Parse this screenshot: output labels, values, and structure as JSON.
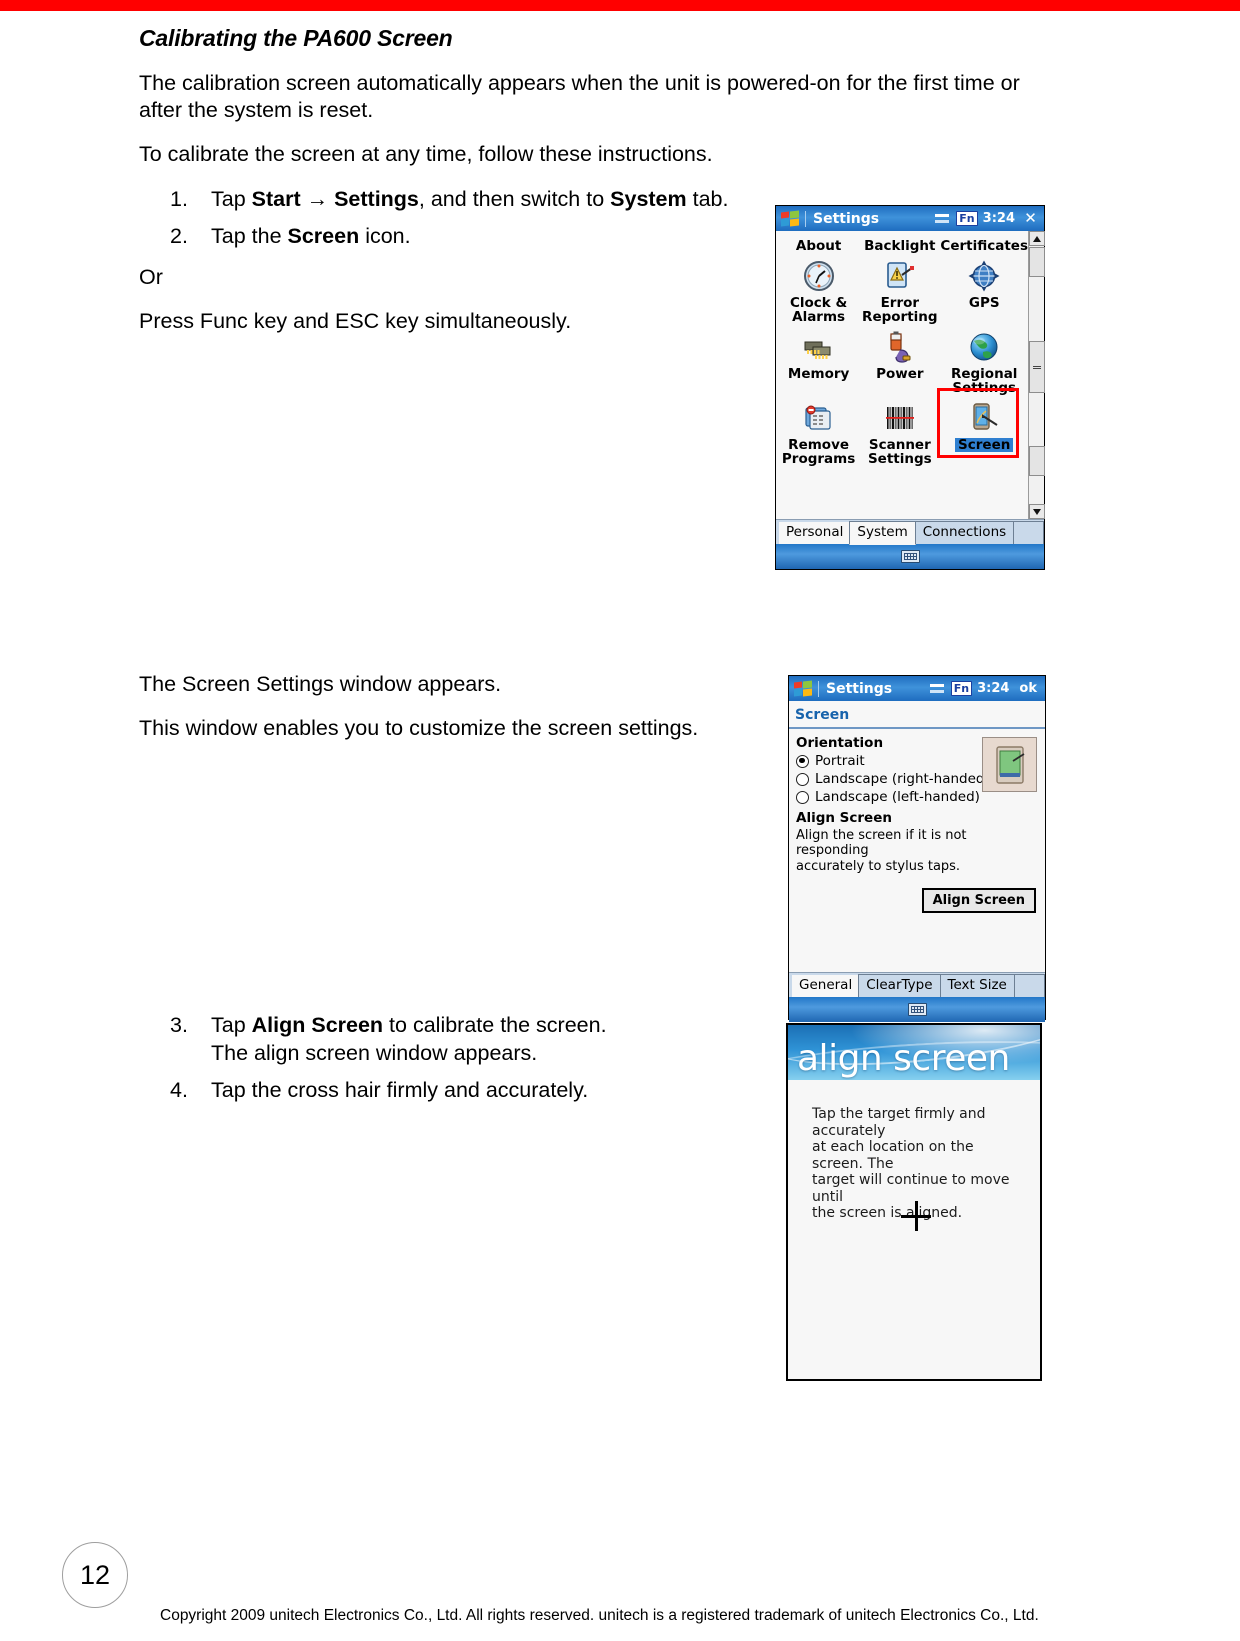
{
  "page": {
    "number": "12",
    "copyright": "Copyright 2009 unitech Electronics Co., Ltd. All rights reserved. unitech is a registered trademark of unitech Electronics Co., Ltd.",
    "accent_red": "#ff0000"
  },
  "section": {
    "title": "Calibrating the PA600 Screen",
    "intro1": "The calibration screen automatically appears when the unit is powered-on for the first time or after the system is reset.",
    "intro2": "To calibrate the screen at any time, follow these instructions.",
    "steps": [
      {
        "num": "1.",
        "pre": "Tap ",
        "b1": "Start",
        "mid1": " → ",
        "b2": "Settings",
        "mid2": ", and then switch to ",
        "b3": "System",
        "post": " tab."
      },
      {
        "num": "2.",
        "pre": "Tap the ",
        "b1": "Screen",
        "mid1": "",
        "b2": "",
        "mid2": "",
        "b3": "",
        "post": " icon."
      }
    ],
    "or_label": "Or",
    "or_text": "Press Func key and ESC key simultaneously.",
    "mid1": "The Screen Settings window appears.",
    "mid2": "This window enables you to customize the screen settings.",
    "step3": {
      "num": "3.",
      "pre": "Tap ",
      "bold": "Align Screen",
      "post": " to calibrate the screen.",
      "sub": "The align screen window appears."
    },
    "step4": {
      "num": "4.",
      "text": "Tap the cross hair firmly and accurately."
    }
  },
  "settings_window": {
    "titlebar": {
      "app": "Settings",
      "fn": "Fn",
      "clock": "3:24",
      "close": "✕"
    },
    "columns": [
      "About",
      "Backlight",
      "Certificates"
    ],
    "cells": [
      {
        "label": "Clock & Alarms",
        "icon": "clock-icon"
      },
      {
        "label": "Error Reporting",
        "icon": "error-reporting-icon"
      },
      {
        "label": "GPS",
        "icon": "gps-icon"
      },
      {
        "label": "Memory",
        "icon": "memory-icon"
      },
      {
        "label": "Power",
        "icon": "power-icon"
      },
      {
        "label": "Regional Settings",
        "icon": "globe-icon"
      },
      {
        "label": "Remove Programs",
        "icon": "remove-programs-icon"
      },
      {
        "label": "Scanner Settings",
        "icon": "barcode-icon"
      },
      {
        "label": "Screen",
        "icon": "screen-icon"
      }
    ],
    "selected_label": "Screen",
    "highlight_color": "#ff0000",
    "tabs": [
      "Personal",
      "System",
      "Connections"
    ],
    "active_tab": "System"
  },
  "screen_window": {
    "titlebar": {
      "app": "Settings",
      "fn": "Fn",
      "clock": "3:24",
      "ok": "ok"
    },
    "page_title": "Screen",
    "orientation": {
      "group_label": "Orientation",
      "options": [
        {
          "label": "Portrait",
          "selected": true
        },
        {
          "label": "Landscape (right-handed)",
          "selected": false
        },
        {
          "label": "Landscape (left-handed)",
          "selected": false
        }
      ]
    },
    "align": {
      "group_label": "Align Screen",
      "hint_line1": "Align the screen if it is not responding",
      "hint_line2": "accurately to stylus taps.",
      "button_label": "Align Screen"
    },
    "tabs": [
      "General",
      "ClearType",
      "Text Size"
    ],
    "active_tab": "General"
  },
  "align_window": {
    "banner_title": "align screen",
    "text_line1": "Tap the target firmly and accurately",
    "text_line2": "at each location on the screen. The",
    "text_line3": "target will continue to move until",
    "text_line4": "the screen is aligned."
  }
}
